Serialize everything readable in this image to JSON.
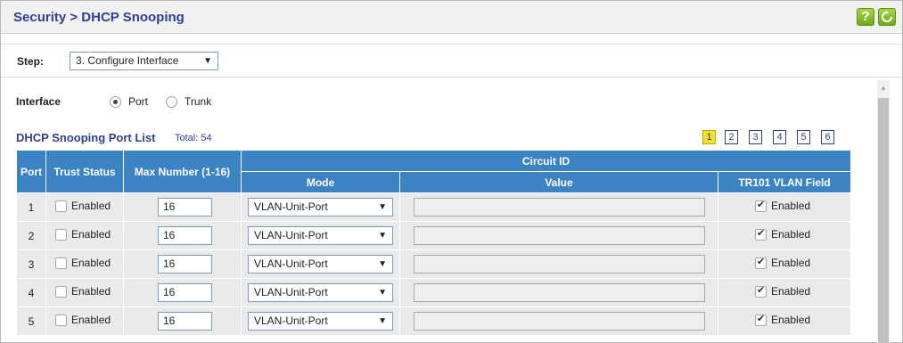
{
  "header": {
    "title": "Security > DHCP Snooping",
    "help_icon": "?"
  },
  "step": {
    "label": "Step:",
    "value": "3. Configure Interface"
  },
  "interface": {
    "label": "Interface",
    "options": [
      "Port",
      "Trunk"
    ],
    "selected": "Port"
  },
  "list": {
    "title": "DHCP Snooping Port List",
    "total": "Total: 54"
  },
  "pager": {
    "pages": [
      "1",
      "2",
      "3",
      "4",
      "5",
      "6"
    ],
    "current": "1"
  },
  "table": {
    "headers": {
      "port": "Port",
      "trust": "Trust Status",
      "max": "Max Number (1-16)",
      "circuit": "Circuit ID",
      "mode": "Mode",
      "value": "Value",
      "tr101": "TR101 VLAN Field"
    },
    "rows": [
      {
        "port": "1",
        "trust": "Enabled",
        "max": "16",
        "mode": "VLAN-Unit-Port",
        "tr101": "Enabled"
      },
      {
        "port": "2",
        "trust": "Enabled",
        "max": "16",
        "mode": "VLAN-Unit-Port",
        "tr101": "Enabled"
      },
      {
        "port": "3",
        "trust": "Enabled",
        "max": "16",
        "mode": "VLAN-Unit-Port",
        "tr101": "Enabled"
      },
      {
        "port": "4",
        "trust": "Enabled",
        "max": "16",
        "mode": "VLAN-Unit-Port",
        "tr101": "Enabled"
      },
      {
        "port": "5",
        "trust": "Enabled",
        "max": "16",
        "mode": "VLAN-Unit-Port",
        "tr101": "Enabled"
      }
    ]
  },
  "colors": {
    "title_blue": "#2f3f8f",
    "header_blue": "#3c83c4",
    "accent_green": "#7cb82f",
    "pager_active": "#f1e232"
  }
}
